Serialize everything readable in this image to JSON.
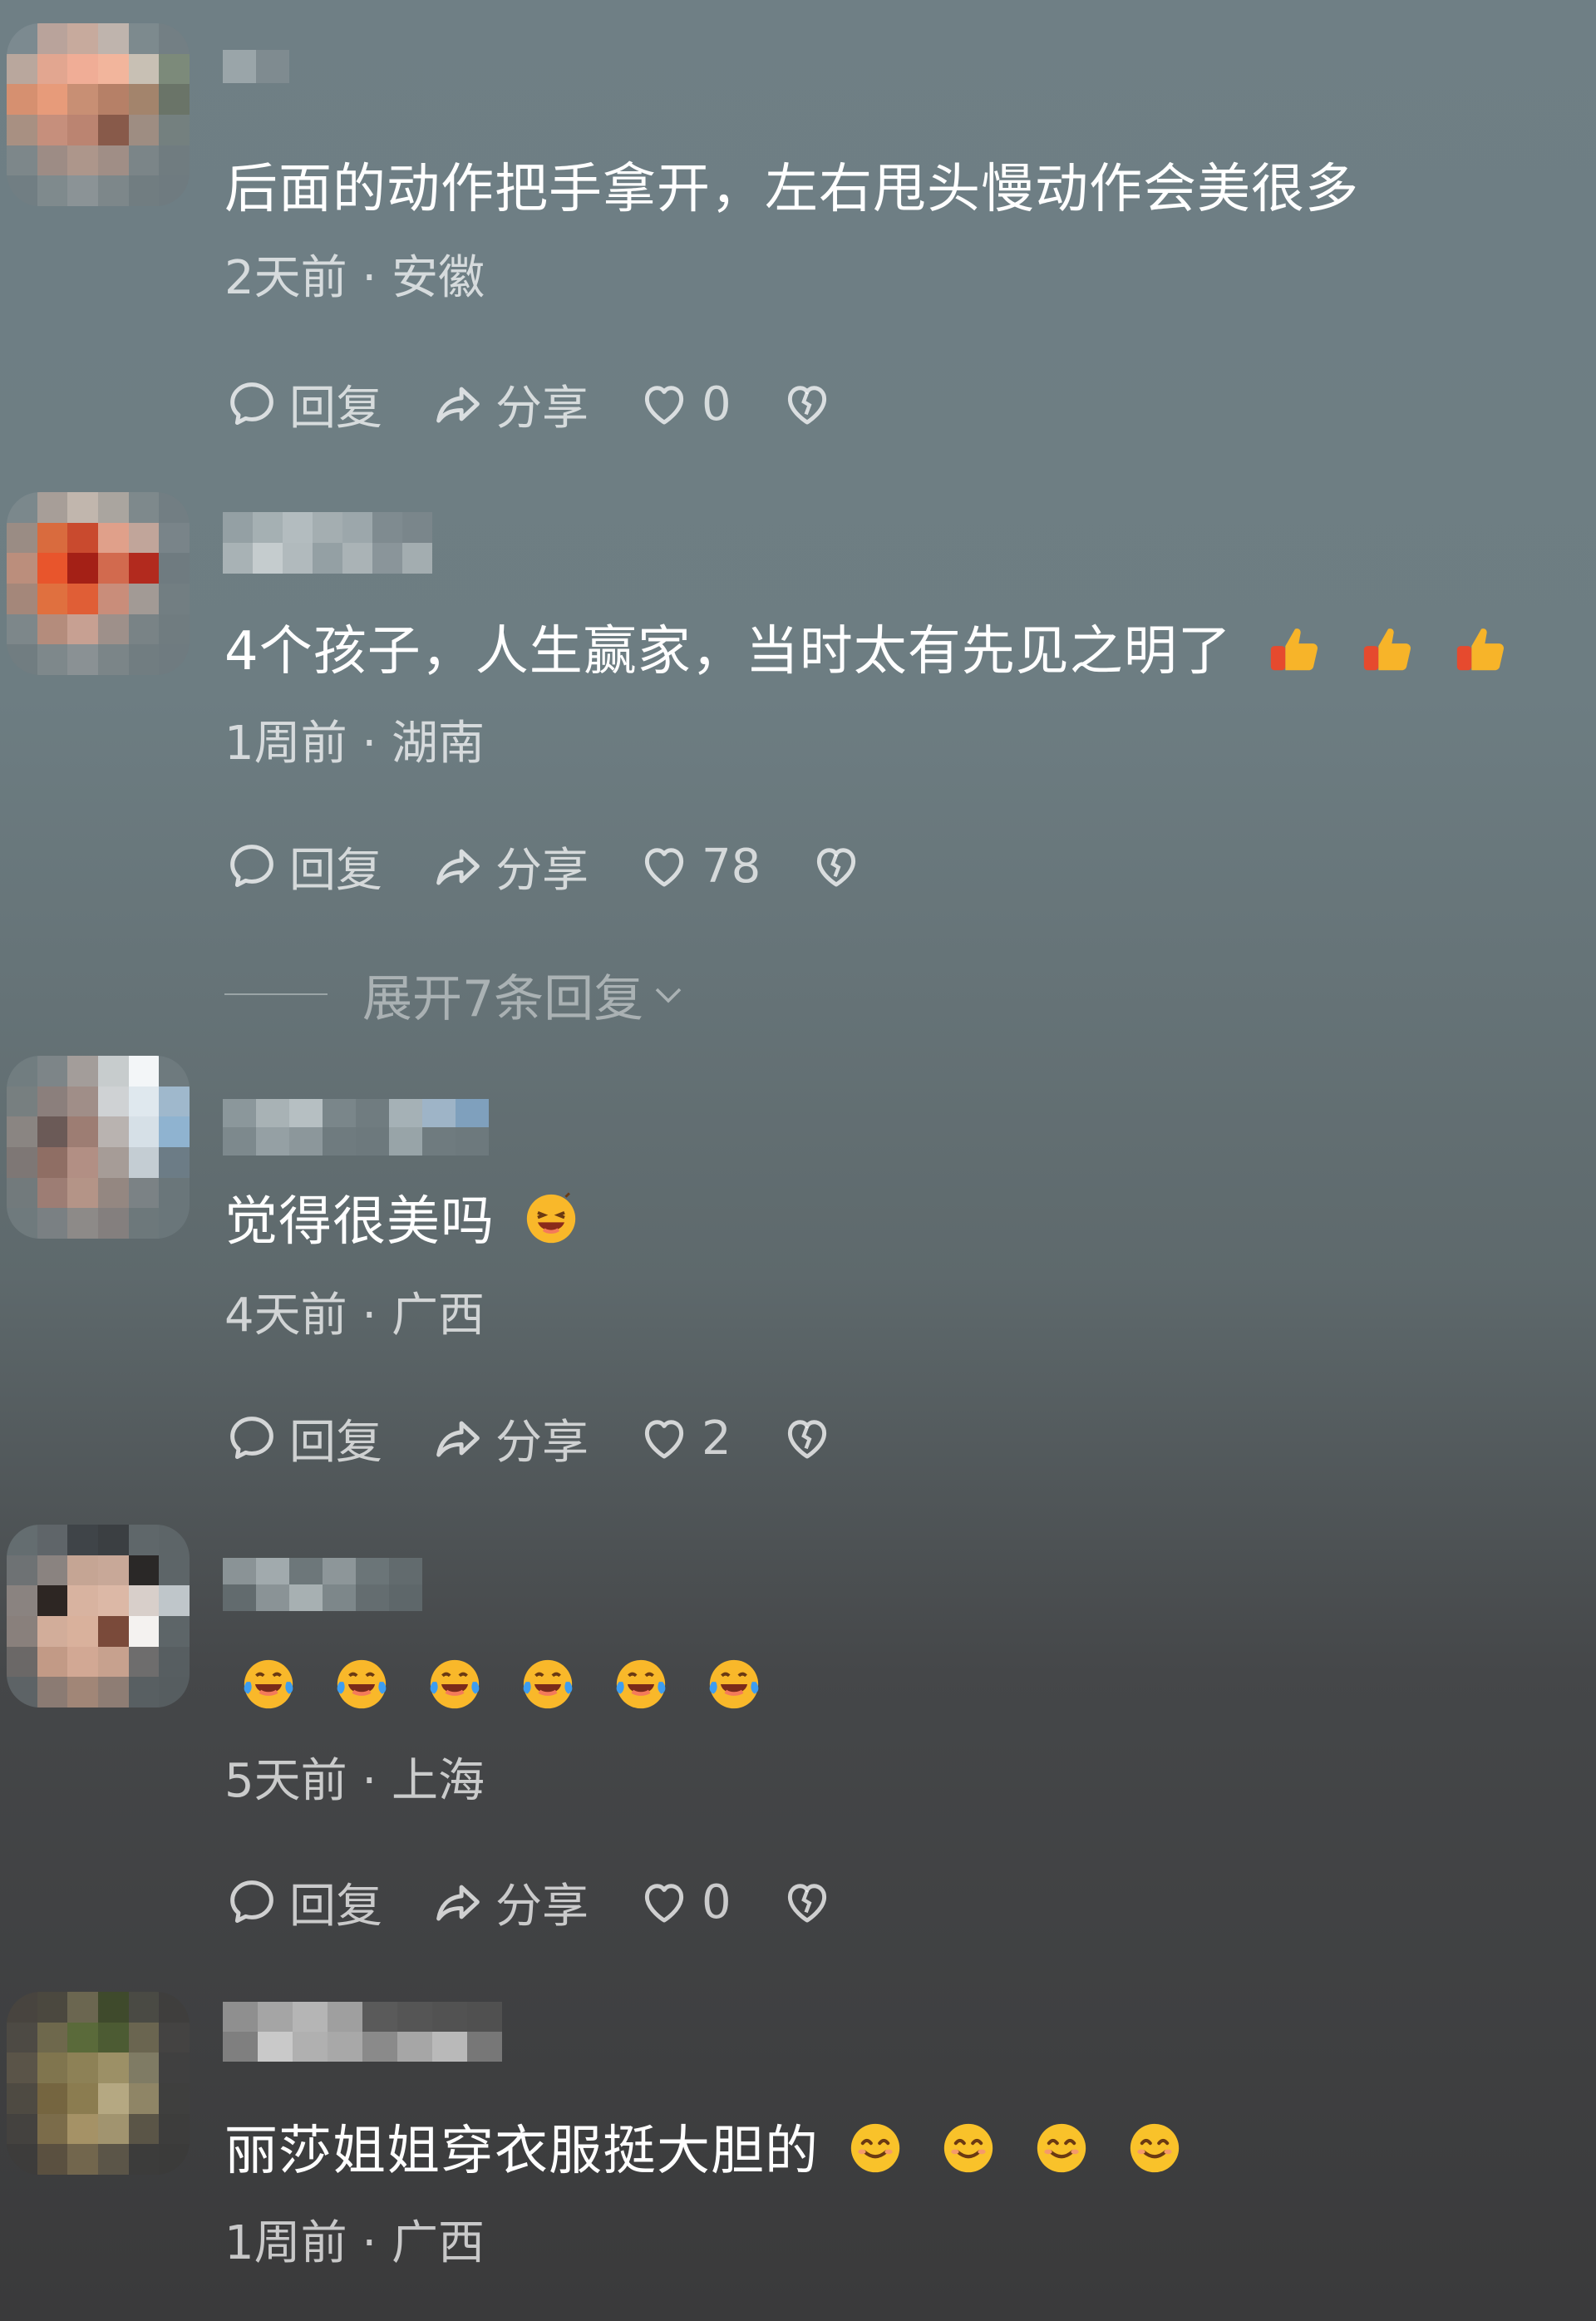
{
  "comments": [
    {
      "text": "后面的动作把手拿开，左右甩头慢动作会美很多",
      "meta": "2天前 · 安徽",
      "reply_label": "回复",
      "share_label": "分享",
      "likes": "0",
      "emojis": []
    },
    {
      "text": "4个孩子，人生赢家，当时太有先见之明了",
      "meta": "1周前 · 湖南",
      "reply_label": "回复",
      "share_label": "分享",
      "likes": "78",
      "emojis": [
        "thumbs-up",
        "thumbs-up",
        "thumbs-up"
      ],
      "expand_label": "展开7条回复"
    },
    {
      "text": "觉得很美吗",
      "meta": "4天前 · 广西",
      "reply_label": "回复",
      "share_label": "分享",
      "likes": "2",
      "emojis": [
        "grinning-squint"
      ]
    },
    {
      "text": "",
      "meta": "5天前 · 上海",
      "reply_label": "回复",
      "share_label": "分享",
      "likes": "0",
      "emojis": [
        "rolling-laughing",
        "rolling-laughing",
        "rolling-laughing",
        "rolling-laughing",
        "rolling-laughing",
        "rolling-laughing"
      ]
    },
    {
      "text": "丽莎姐姐穿衣服挺大胆的",
      "meta": "1周前 · 广西",
      "emojis": [
        "smiling-eyes",
        "smiling-eyes",
        "smiling-eyes",
        "smiling-eyes"
      ]
    }
  ],
  "icons": {
    "reply": "comment-bubble-icon",
    "share": "share-arrow-icon",
    "like": "heart-icon",
    "dislike": "broken-heart-icon",
    "expand": "chevron-down-icon"
  },
  "colors": {
    "text": "#ffffff",
    "muted": "rgba(255,255,255,0.72)",
    "thumb": "#f7b429",
    "emoji_yellow": "#f9c22a"
  }
}
